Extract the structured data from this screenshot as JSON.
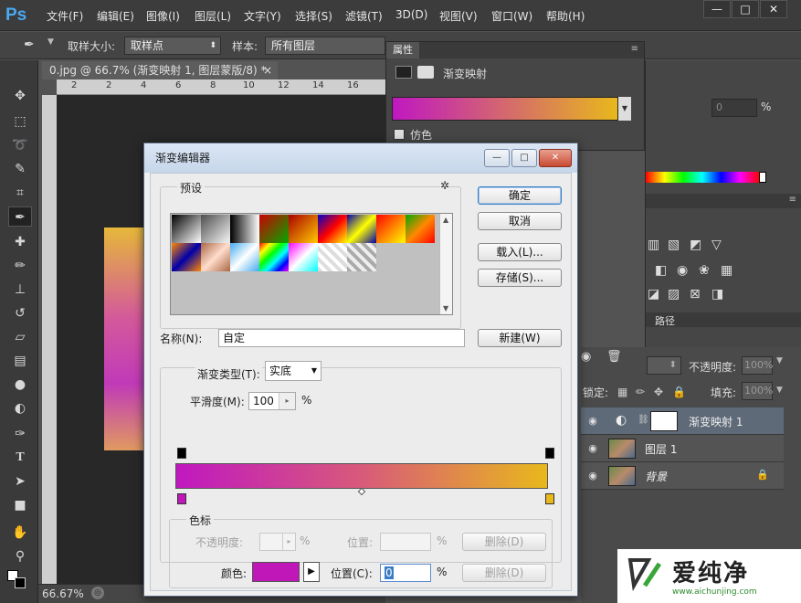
{
  "app": {
    "logo": "Ps"
  },
  "menu": [
    "文件(F)",
    "编辑(E)",
    "图像(I)",
    "图层(L)",
    "文字(Y)",
    "选择(S)",
    "滤镜(T)",
    "3D(D)",
    "视图(V)",
    "窗口(W)",
    "帮助(H)"
  ],
  "window_buttons": {
    "minimize": "—",
    "restore": "□",
    "close": "✕"
  },
  "options": {
    "sample_size_label": "取样大小:",
    "sample_size_value": "取样点",
    "sample_label": "样本:",
    "sample_value": "所有图层"
  },
  "document": {
    "tab": "0.jpg @ 66.7% (渐变映射 1, 图层蒙版/8) *",
    "close": "×",
    "zoom": "66.67%"
  },
  "ruler": {
    "marks": [
      "2",
      "2",
      "4",
      "6",
      "8",
      "10",
      "12",
      "14",
      "16"
    ]
  },
  "properties": {
    "tab": "属性",
    "title": "渐变映射",
    "dither": "仿色",
    "percent_value": "0",
    "percent_sign": "%"
  },
  "layers_panel": {
    "paths_tab": "路径",
    "opacity_label": "不透明度:",
    "opacity_value": "100%",
    "lock_label": "锁定:",
    "fill_label": "填充:",
    "fill_value": "100%",
    "layers": [
      {
        "name": "渐变映射 1",
        "italic": false
      },
      {
        "name": "图层 1",
        "italic": false
      },
      {
        "name": "背景",
        "italic": true
      }
    ]
  },
  "dialog": {
    "title": "渐变编辑器",
    "presets_label": "预设",
    "ok": "确定",
    "cancel": "取消",
    "load": "载入(L)...",
    "save": "存储(S)...",
    "name_label": "名称(N):",
    "name_value": "自定",
    "new": "新建(W)",
    "gradient_type_label": "渐变类型(T):",
    "gradient_type_value": "实底",
    "smoothness_label": "平滑度(M):",
    "smoothness_value": "100",
    "smoothness_unit": "%",
    "stops_label": "色标",
    "opacity_label": "不透明度:",
    "opacity_unit": "%",
    "position_label": "位置:",
    "position_unit": "%",
    "delete": "删除(D)",
    "color_label": "颜色:",
    "color_value": "#c018b8",
    "position_c_label": "位置(C):",
    "position_c_value": "0",
    "position_c_unit": "%"
  },
  "watermark": {
    "text": "爱纯净",
    "url": "www.aichunjing.com"
  }
}
